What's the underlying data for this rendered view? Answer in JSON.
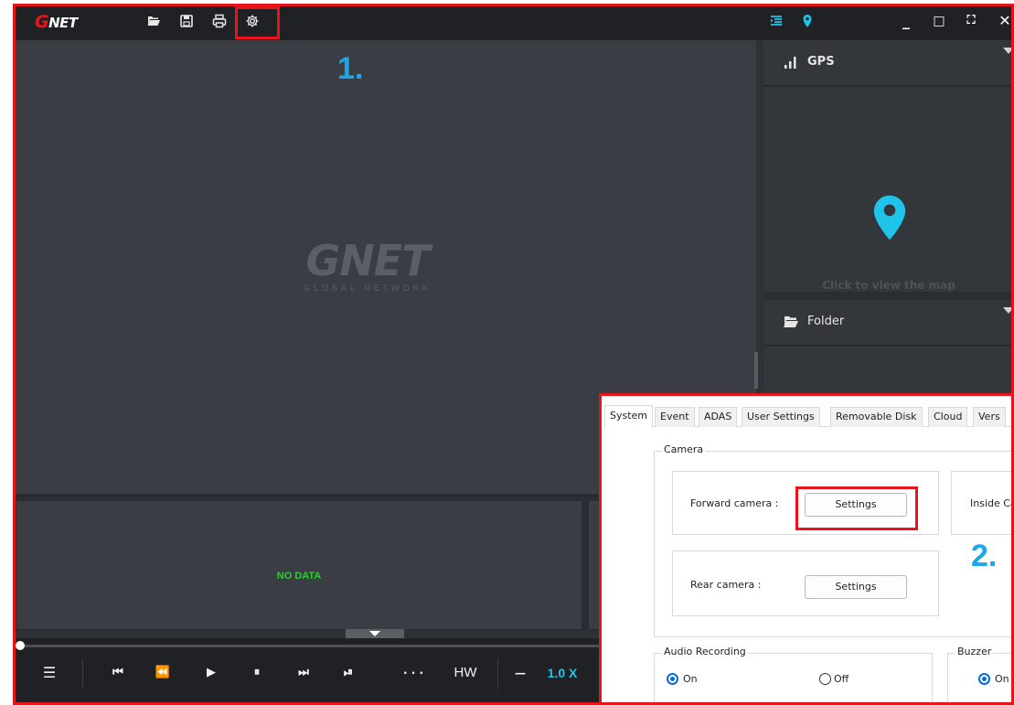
{
  "titlebar": {
    "logo_text": "NET",
    "logo_letter": "G",
    "icons": [
      "folder-open-icon",
      "save-icon",
      "print-icon",
      "gear-icon",
      "list-icon",
      "map-pin-icon"
    ],
    "window_buttons": {
      "minimize": "_",
      "maximize": "□",
      "fullscreen": "⛶",
      "close": "✕"
    }
  },
  "annotations": {
    "step1": "1.",
    "step2": "2."
  },
  "player": {
    "watermark": "NET",
    "watermark_letter": "G",
    "watermark_sub": "GLOBAL NETWORK",
    "no_data": "NO DATA"
  },
  "gps_panel": {
    "title": "GPS",
    "hint": "Click to view the map"
  },
  "folder_panel": {
    "title": "Folder"
  },
  "controls": {
    "menu": "☰",
    "first": "⏮",
    "prev": "⏪",
    "play": "▶",
    "pause": "⏸",
    "next": "⏭",
    "last": "⏯",
    "more": "· · ·",
    "hw": "HW",
    "minus": "—",
    "speed": "1.0 X"
  },
  "settings_dialog": {
    "tabs": [
      "System",
      "Event",
      "ADAS",
      "User Settings",
      "Removable Disk",
      "Cloud",
      "Vers"
    ],
    "active_tab": "System",
    "camera_group": "Camera",
    "forward_camera_label": "Forward camera :",
    "forward_camera_button": "Settings",
    "inside_camera_label": "Inside Ca",
    "rear_camera_label": "Rear camera :",
    "rear_camera_button": "Settings",
    "audio_group": "Audio Recording",
    "audio_on": "On",
    "audio_off": "Off",
    "buzzer_group": "Buzzer",
    "buzzer_on": "On"
  },
  "colors": {
    "accent": "#20c4ea",
    "highlight": "#e8141b",
    "no_data": "#28d12d"
  }
}
